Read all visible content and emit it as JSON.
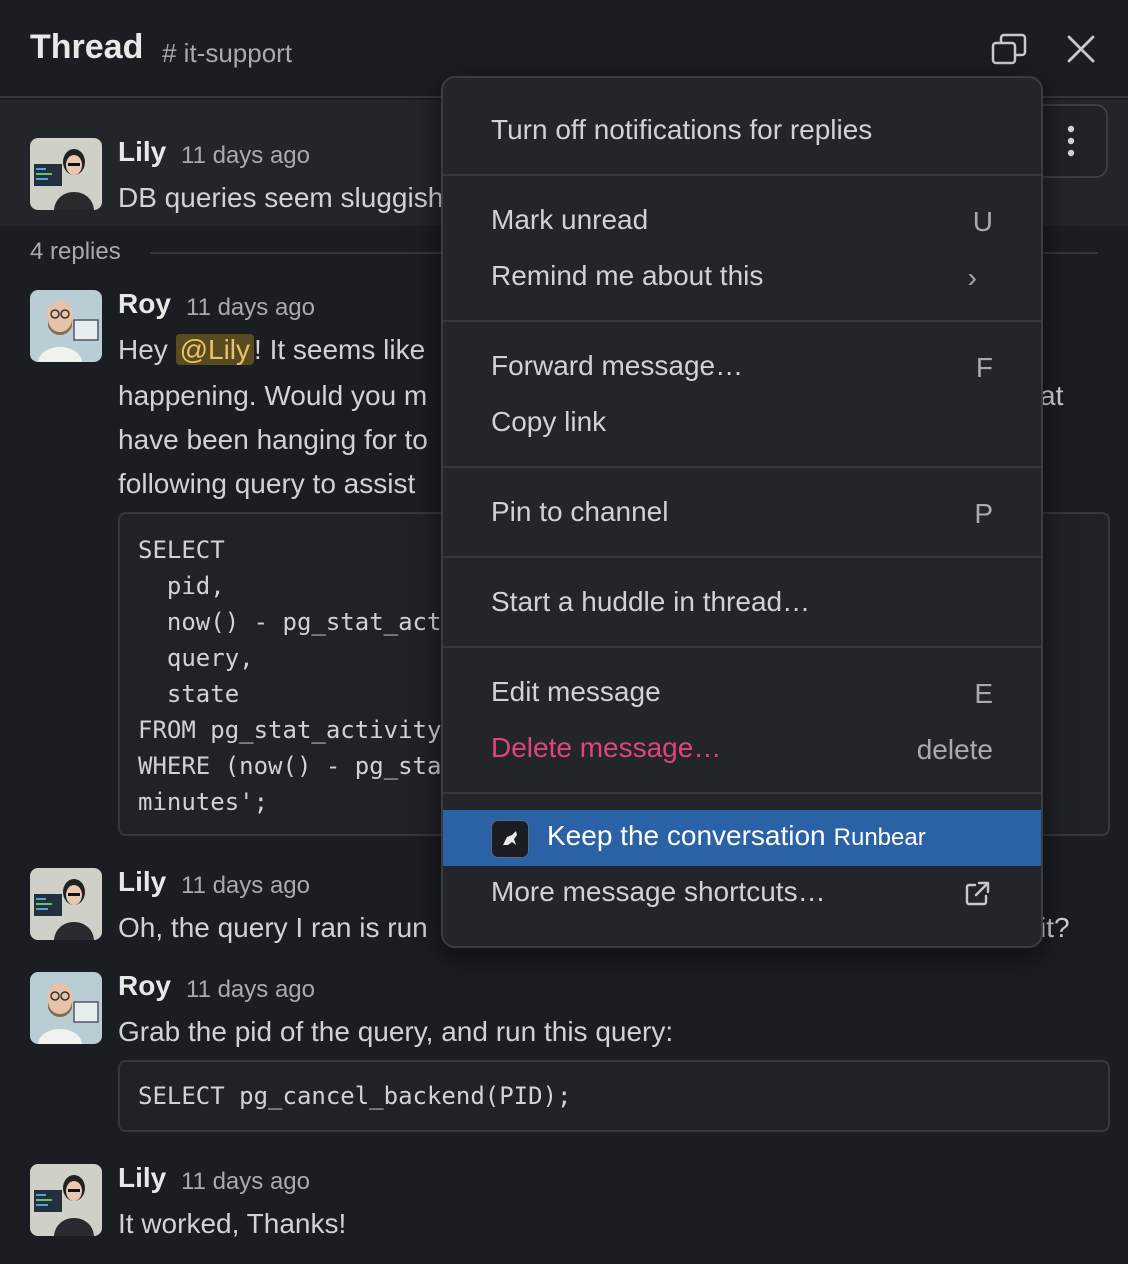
{
  "header": {
    "title": "Thread",
    "channel": "# it-support"
  },
  "parent": {
    "author": "Lily",
    "time": "11 days ago",
    "text": "DB queries seem sluggish"
  },
  "replies_count": "4 replies",
  "messages": [
    {
      "author": "Roy",
      "time": "11 days ago",
      "text_prefix": "Hey ",
      "mention": "@Lily",
      "lines": [
        "! It seems like",
        "happening. Would you m",
        "have been hanging for to",
        "following query to assist"
      ],
      "line_tail": "at",
      "code": "SELECT\n  pid,\n  now() - pg_stat_act\n  query,\n  state\nFROM pg_stat_activity\nWHERE (now() - pg_sta\nminutes';"
    },
    {
      "author": "Lily",
      "time": "11 days ago",
      "text": "Oh, the query I ran is run",
      "text_tail": "it?"
    },
    {
      "author": "Roy",
      "time": "11 days ago",
      "text": "Grab the pid of the query, and run this query:",
      "code": "SELECT pg_cancel_backend(PID);"
    },
    {
      "author": "Lily",
      "time": "11 days ago",
      "text": "It worked, Thanks!"
    }
  ],
  "menu": {
    "turn_off_notifications": "Turn off notifications for replies",
    "mark_unread": "Mark unread",
    "mark_unread_key": "U",
    "remind_me": "Remind me about this",
    "remind_me_chevron": "›",
    "forward": "Forward message…",
    "forward_key": "F",
    "copy_link": "Copy link",
    "pin": "Pin to channel",
    "pin_key": "P",
    "huddle": "Start a huddle in thread…",
    "edit": "Edit message",
    "edit_key": "E",
    "delete": "Delete message…",
    "delete_key": "delete",
    "keep_conversation": "Keep the conversation",
    "keep_conversation_app": "Runbear",
    "more_shortcuts": "More message shortcuts…"
  },
  "colors": {
    "background": "#1a1d21",
    "menu_highlight": "#2b62a6",
    "danger": "#e0447a",
    "mention_bg": "#5a4a1f"
  },
  "icons": {
    "popout": "popout-icon",
    "close": "close-icon",
    "more": "more-vertical-icon",
    "external": "external-link-icon",
    "app": "runbear-app-icon"
  }
}
